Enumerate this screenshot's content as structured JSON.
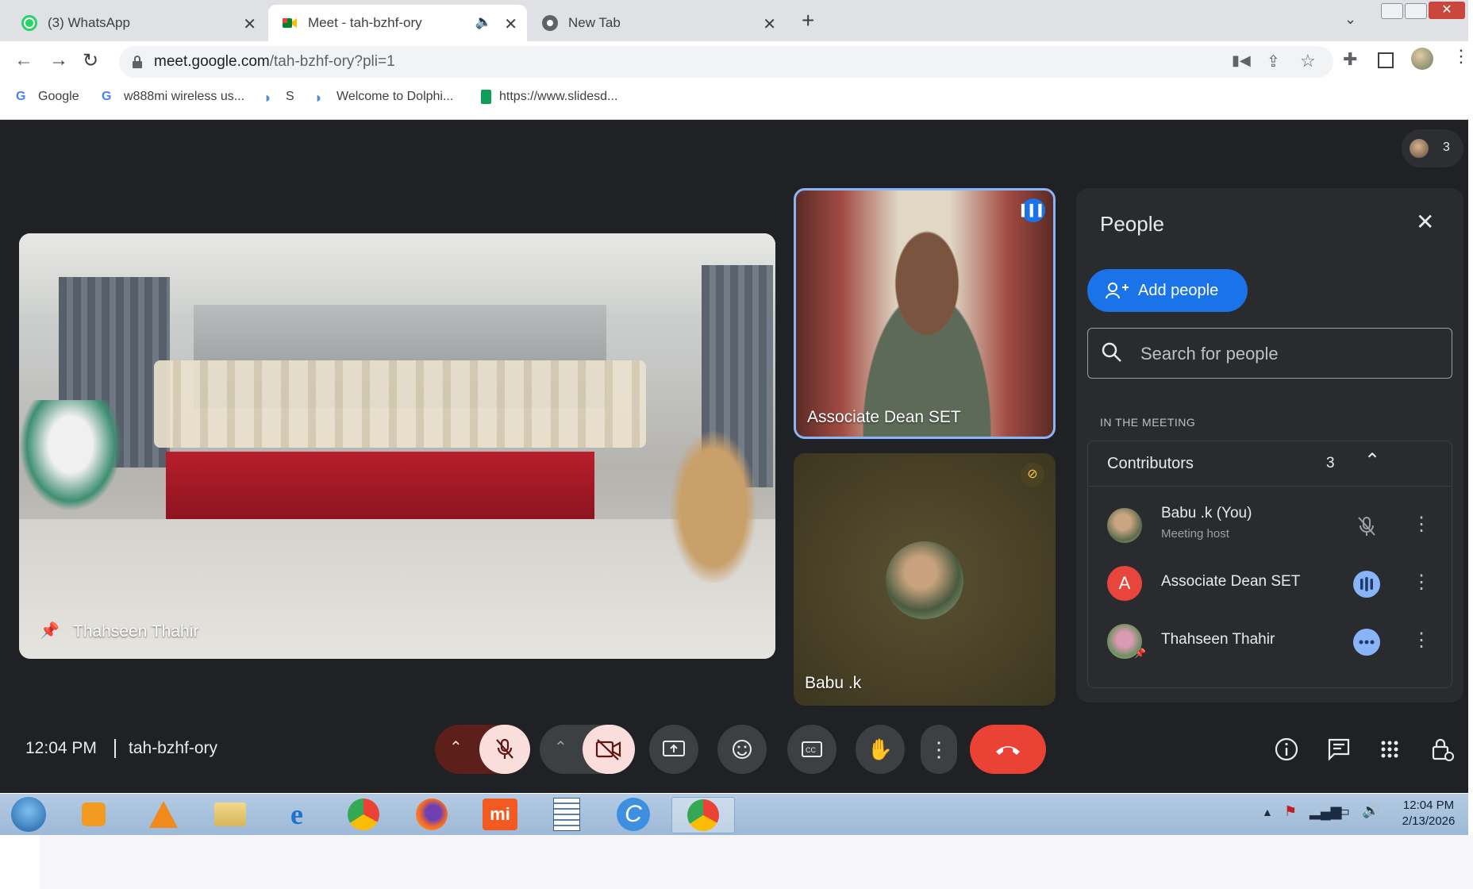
{
  "browser": {
    "tabs": [
      {
        "title": "(3) WhatsApp",
        "icon": "whatsapp-icon",
        "active": false
      },
      {
        "title": "Meet - tah-bzhf-ory",
        "icon": "meet-icon",
        "active": true
      },
      {
        "title": "New Tab",
        "icon": "chrome-icon",
        "active": false
      }
    ],
    "url_host": "meet.google.com",
    "url_path": "/tah-bzhf-ory?pli=1",
    "bookmarks": [
      {
        "label": "Google"
      },
      {
        "label": "w888mi wireless us..."
      },
      {
        "label": "S"
      },
      {
        "label": "Welcome to Dolphi..."
      },
      {
        "label": "https://www.slidesd..."
      }
    ]
  },
  "meet": {
    "participant_count": "3",
    "tiles": {
      "main_name": "Thahseen Thahir",
      "speaker_name": "Associate Dean SET",
      "self_name": "Babu .k"
    },
    "clock": "12:04 PM",
    "meeting_code": "tah-bzhf-ory",
    "people_panel": {
      "title": "People",
      "add_label": "Add people",
      "search_placeholder": "Search for people",
      "section_label": "IN THE MEETING",
      "group_label": "Contributors",
      "group_count": "3",
      "people": [
        {
          "name": "Babu .k (You)",
          "role": "Meeting host",
          "status": "mic-off"
        },
        {
          "name": "Associate Dean SET",
          "initial": "A",
          "status": "speaking"
        },
        {
          "name": "Thahseen Thahir",
          "status": "more"
        }
      ]
    }
  },
  "taskbar": {
    "time": "12:04 PM",
    "date": "2/13/2026"
  },
  "colors": {
    "stage": "#202124",
    "panel": "#2a2b2f",
    "accent": "#1a73e8",
    "danger": "#ea4335",
    "muted_btn": "#f9dedc"
  }
}
